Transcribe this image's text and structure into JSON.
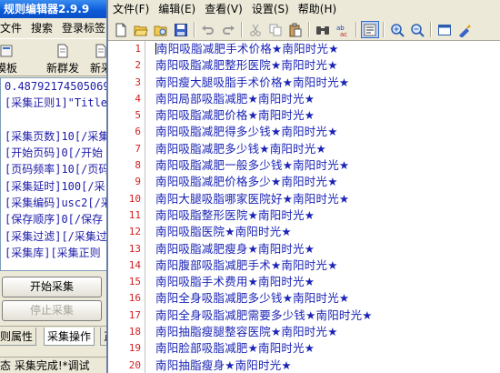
{
  "background_app": {
    "title": "规则编辑器2.9.9",
    "menu": [
      "文件",
      "搜索",
      "登录标签"
    ],
    "toolbar": [
      "模板",
      "新群发",
      "新采"
    ],
    "editor_lines": [
      "0.48792174505069",
      "[采集正则1]\"Title",
      "",
      "[采集页数]10[/采集",
      "[开始页码]0[/开始",
      "[页码频率]10[/页码",
      "[采集延时]100[/采",
      "[采集编码]usc2[/采",
      "[保存顺序]0[/保存",
      "[采集过滤][/采集过",
      "[采集库][采集正则"
    ],
    "start_button": "开始采集",
    "stop_button": "停止采集",
    "tabs": [
      "则属性",
      "采集操作",
      "正"
    ],
    "status": "态  采集完成!*调试"
  },
  "editor": {
    "menu": [
      "文件(F)",
      "编辑(E)",
      "查看(V)",
      "设置(S)",
      "帮助(H)"
    ],
    "toolbar_icons": [
      "new-file-icon",
      "open-folder-icon",
      "browse-icon",
      "save-icon",
      "undo-icon",
      "redo-icon",
      "cut-icon",
      "copy-icon",
      "paste-icon",
      "find-icon",
      "replace-icon",
      "word-wrap-icon",
      "zoom-in-icon",
      "zoom-out-icon",
      "view-icon",
      "settings-icon"
    ],
    "line_numbers": [
      "1",
      "2",
      "3",
      "4",
      "5",
      "6",
      "7",
      "8",
      "9",
      "10",
      "11",
      "12",
      "13",
      "14",
      "15",
      "16",
      "17",
      "18",
      "19",
      "20",
      "21"
    ],
    "lines": [
      "南阳吸脂减肥手术价格★南阳时光★",
      "南阳吸脂减肥整形医院★南阳时光★",
      "南阳瘦大腿吸脂手术价格★南阳时光★",
      "南阳局部吸脂减肥★南阳时光★",
      "南阳吸脂减肥价格★南阳时光★",
      "南阳吸脂减肥得多少钱★南阳时光★",
      "南阳吸脂减肥多少钱★南阳时光★",
      "南阳吸脂减肥一般多少钱★南阳时光★",
      "南阳吸脂减肥价格多少★南阳时光★",
      "南阳大腿吸脂哪家医院好★南阳时光★",
      "南阳吸脂整形医院★南阳时光★",
      "南阳吸脂医院★南阳时光★",
      "南阳吸脂减肥瘦身★南阳时光★",
      "南阳腹部吸脂减肥手术★南阳时光★",
      "南阳吸脂手术费用★南阳时光★",
      "南阳全身吸脂减肥多少钱★南阳时光★",
      "南阳全身吸脂减肥需要多少钱★南阳时光★",
      "南阳抽脂瘦腿整容医院★南阳时光★",
      "南阳脸部吸脂减肥★南阳时光★",
      "南阳抽脂瘦身★南阳时光★",
      "南阳抽脂减肥好吗★南阳时光★"
    ]
  }
}
